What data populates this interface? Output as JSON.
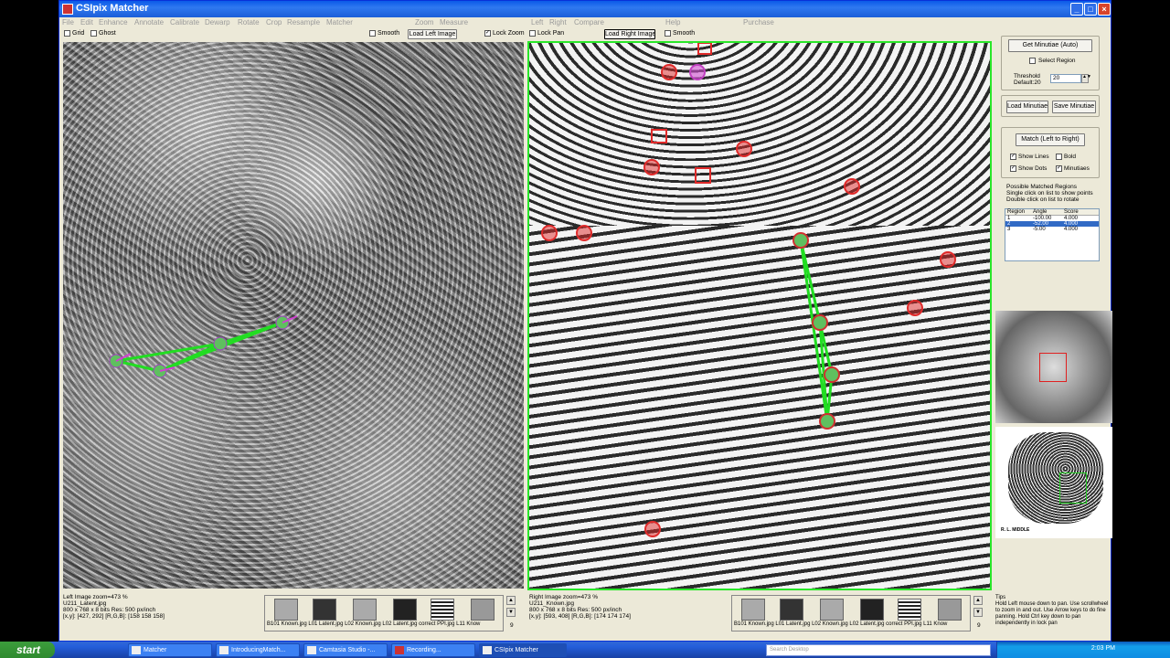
{
  "window": {
    "title": "CSIpix Matcher"
  },
  "menu": [
    "File",
    "Edit",
    "Enhance",
    "Annotate",
    "Calibrate",
    "Dewarp",
    "Rotate",
    "Crop",
    "Resample",
    "Matcher",
    "Zoom",
    "Measure",
    "Left",
    "Right",
    "Compare",
    "Help",
    "Purchase"
  ],
  "toolbar": {
    "grid": "Grid",
    "ghost": "Ghost",
    "smooth_left": "Smooth",
    "load_left": "Load Left Image",
    "lock_zoom": "Lock Zoom",
    "lock_pan": "Lock Pan",
    "load_right": "Load Right Image",
    "smooth_right": "Smooth"
  },
  "side": {
    "get_minutiae": "Get Minutiae (Auto)",
    "select_region": "Select Region",
    "threshold_label1": "Threshold",
    "threshold_label2": "Default:20",
    "threshold_value": "20",
    "load_minutiae": "Load Minutiae",
    "save_minutiae": "Save Minutiae",
    "match": "Match (Left to Right)",
    "show_lines": "Show Lines",
    "bold": "Bold",
    "show_dots": "Show Dots",
    "minutiaes": "Minutiaes",
    "regions_title": "Possible Matched Regions",
    "regions_hint1": "Single click on list to show points",
    "regions_hint2": "Double click on list to rotate",
    "table": {
      "headers": [
        "Region",
        "Angle",
        "Score"
      ],
      "rows": [
        [
          "1",
          "-100.00",
          "4.000"
        ],
        [
          "2",
          "-52.00",
          "4.000"
        ],
        [
          "3",
          "-5.00",
          "4.000"
        ]
      ]
    },
    "thumb_caption": "R. L. MIDDLE"
  },
  "left_info": {
    "title": "Left Image   zoom=473 %",
    "file": "U211_Latent.jpg",
    "dims": "800 x 768 x 8 bits     Res: 500 px/inch",
    "coords": "[x,y]: [427, 292]   [R,G,B]: [158 158 158]"
  },
  "right_info": {
    "title": "Right Image   zoom=473 %",
    "file": "U211_Known.jpg",
    "dims": "800 x 768 x 8 bits     Res: 500 px/inch",
    "coords": "[x,y]: [593, 408]   [R,G,B]: [174 174 174]"
  },
  "strip": {
    "left_caption": "B101  Known.jpg L01  Latent.jpg L02  Known.jpg L02  Latent.jpg correct  PPI.jpg L11  Know",
    "right_caption": "B101  Known.jpg L01  Latent.jpg L02  Known.jpg L02  Latent.jpg correct  PPI.jpg L11  Know",
    "page_left": "9",
    "page_right": "9"
  },
  "tips": {
    "title": "Tips",
    "body": "Hold Left mouse down to pan.  Use scrollwheel to zoom in and out.  Use Arrow keys to do fine panning. Hold Ctrl key down to pan independently in lock pan"
  },
  "taskbar": {
    "start": "start",
    "tasks": [
      "Matcher",
      "IntroducingMatch...",
      "Camtasia Studio -...",
      "Recording...",
      "CSIpix Matcher"
    ],
    "search_placeholder": "Search Desktop",
    "clock": "2:03 PM"
  }
}
